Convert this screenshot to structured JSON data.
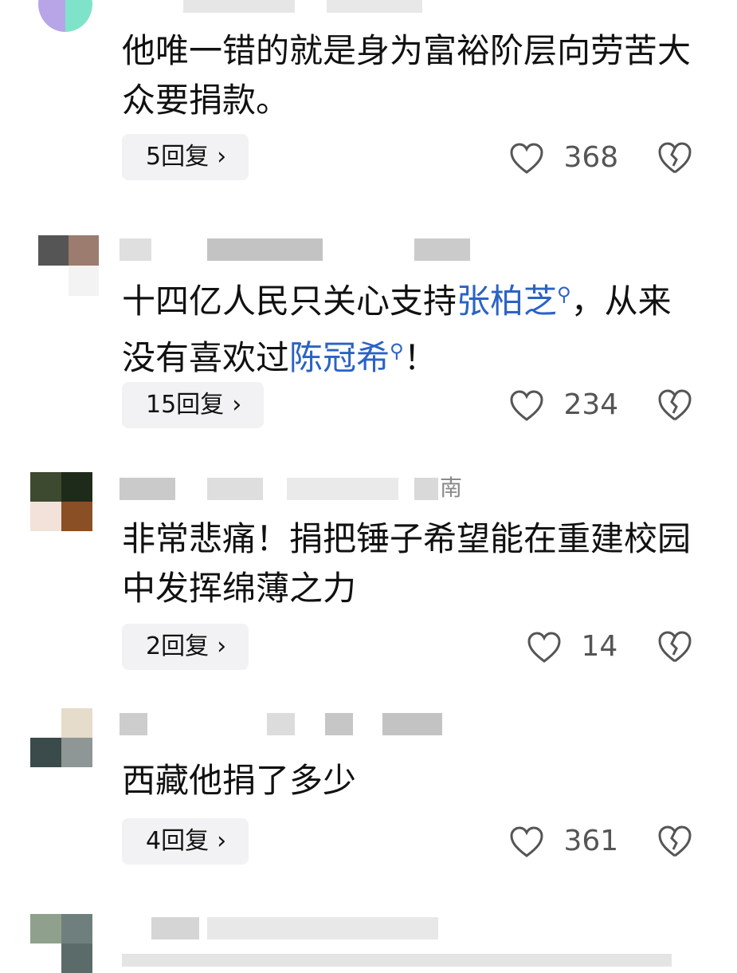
{
  "comments": [
    {
      "meta_visible": "",
      "text": "他唯一错的就是身为富裕阶层向劳苦大众要捐款。",
      "replies": "5回复",
      "likes": "368"
    },
    {
      "meta_visible": "",
      "text_parts": [
        "十四亿人民只关心支持",
        "张柏芝",
        "，从来没有喜欢过",
        "陈冠希",
        "！"
      ],
      "replies": "15回复",
      "likes": "234"
    },
    {
      "meta_visible": "南",
      "text": "非常悲痛！捐把锤子希望能在重建校园中发挥绵薄之力",
      "replies": "2回复",
      "likes": "14"
    },
    {
      "meta_visible": "",
      "text": "西藏他捐了多少",
      "replies": "4回复",
      "likes": "361"
    }
  ],
  "icons": {
    "like": "heart-outline-icon",
    "dislike": "broken-heart-icon",
    "chevron": "chevron-right-icon",
    "search_hint": "search-icon"
  },
  "colors": {
    "link": "#2b63c4",
    "reply_bg": "#f2f2f4",
    "text": "#111111",
    "muted": "#555555"
  }
}
